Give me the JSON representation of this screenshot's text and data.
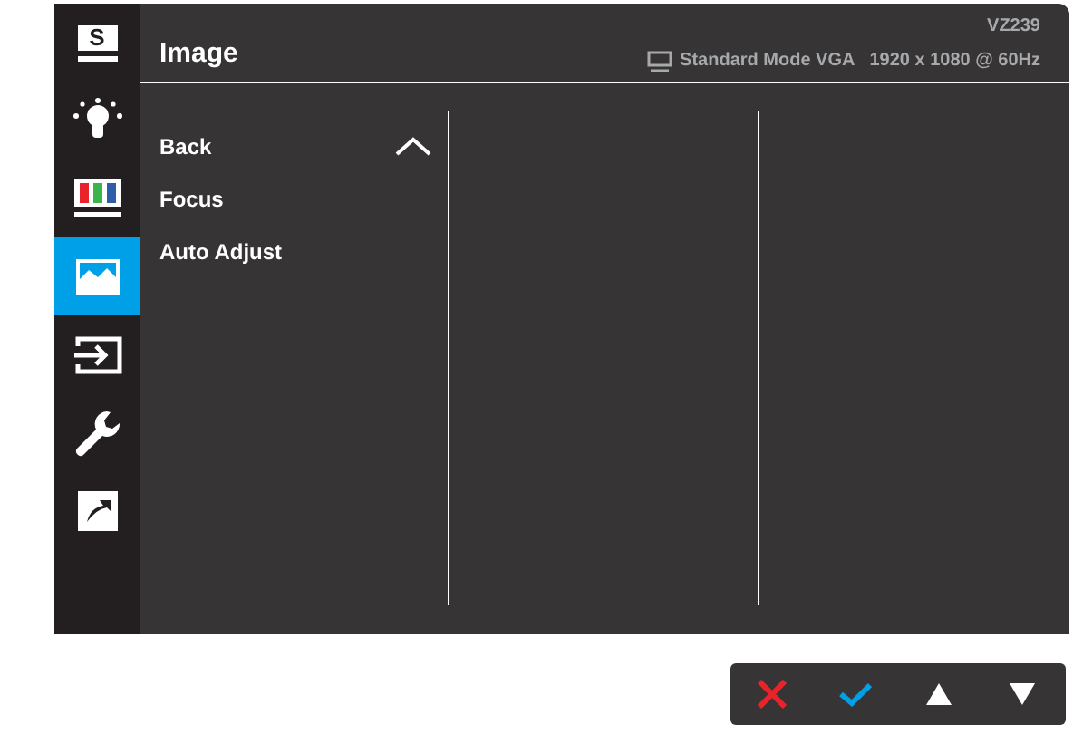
{
  "sidebar": {
    "items": [
      {
        "kind": "splendid",
        "label": "S",
        "selected": false
      },
      {
        "kind": "bluelight",
        "selected": false
      },
      {
        "kind": "color",
        "selected": false
      },
      {
        "kind": "image",
        "selected": true
      },
      {
        "kind": "input",
        "selected": false
      },
      {
        "kind": "setup",
        "selected": false
      },
      {
        "kind": "shortcut",
        "selected": false
      }
    ]
  },
  "header": {
    "title": "Image",
    "model": "VZ239",
    "mode": "Standard Mode VGA",
    "resolution": "1920 x 1080 @ 60Hz"
  },
  "menu": {
    "items": [
      {
        "label": "Back",
        "kind": "back"
      },
      {
        "label": "Focus",
        "kind": "item"
      },
      {
        "label": "Auto Adjust",
        "kind": "item"
      }
    ]
  },
  "keys": [
    {
      "kind": "close"
    },
    {
      "kind": "ok"
    },
    {
      "kind": "up"
    },
    {
      "kind": "down"
    }
  ]
}
